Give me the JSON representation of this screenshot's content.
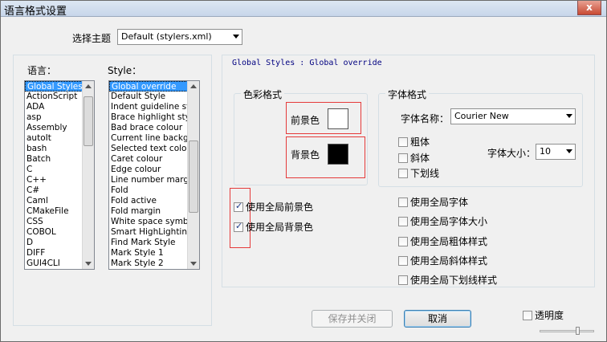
{
  "window": {
    "title": "语言格式设置",
    "close_glyph": "x"
  },
  "theme": {
    "label": "选择主题",
    "value": "Default (stylers.xml)"
  },
  "language_list": {
    "label": "语言：",
    "items": [
      "Global Styles",
      "ActionScript",
      "ADA",
      "asp",
      "Assembly",
      "autoIt",
      "bash",
      "Batch",
      "C",
      "C++",
      "C#",
      "Caml",
      "CMakeFile",
      "CSS",
      "COBOL",
      "D",
      "DIFF",
      "GUI4CLI"
    ],
    "selected_index": 0
  },
  "style_list": {
    "label": "Style：",
    "items": [
      "Global override",
      "Default Style",
      "Indent guideline sty",
      "Brace highlight style",
      "Bad brace colour",
      "Current line backgr",
      "Selected text colou",
      "Caret colour",
      "Edge colour",
      "Line number margin",
      "Fold",
      "Fold active",
      "Fold margin",
      "White space symbo",
      "Smart HighLighting",
      "Find Mark Style",
      "Mark Style 1",
      "Mark Style 2"
    ],
    "selected_index": 0
  },
  "style_header": "Global Styles : Global override",
  "color_group": {
    "title": "色彩格式",
    "fg_label": "前景色",
    "bg_label": "背景色",
    "fg_color": "#ffffff",
    "bg_color": "#000000"
  },
  "font_group": {
    "title": "字体格式",
    "name_label": "字体名称：",
    "name_value": "Courier New",
    "bold": "粗体",
    "italic": "斜体",
    "underline": "下划线",
    "size_label": "字体大小：",
    "size_value": "10"
  },
  "global_checks": {
    "use_global_fg": "使用全局前景色",
    "use_global_bg": "使用全局背景色",
    "use_global_font": "使用全局字体",
    "use_global_font_size": "使用全局字体大小",
    "use_global_bold": "使用全局粗体样式",
    "use_global_italic": "使用全局斜体样式",
    "use_global_underline": "使用全局下划线样式"
  },
  "buttons": {
    "save_close": "保存并关闭",
    "cancel": "取消"
  },
  "transparency": {
    "label": "透明度"
  },
  "colors": {
    "highlight_red": "#e53a3a",
    "selection_blue": "#3399ff"
  }
}
